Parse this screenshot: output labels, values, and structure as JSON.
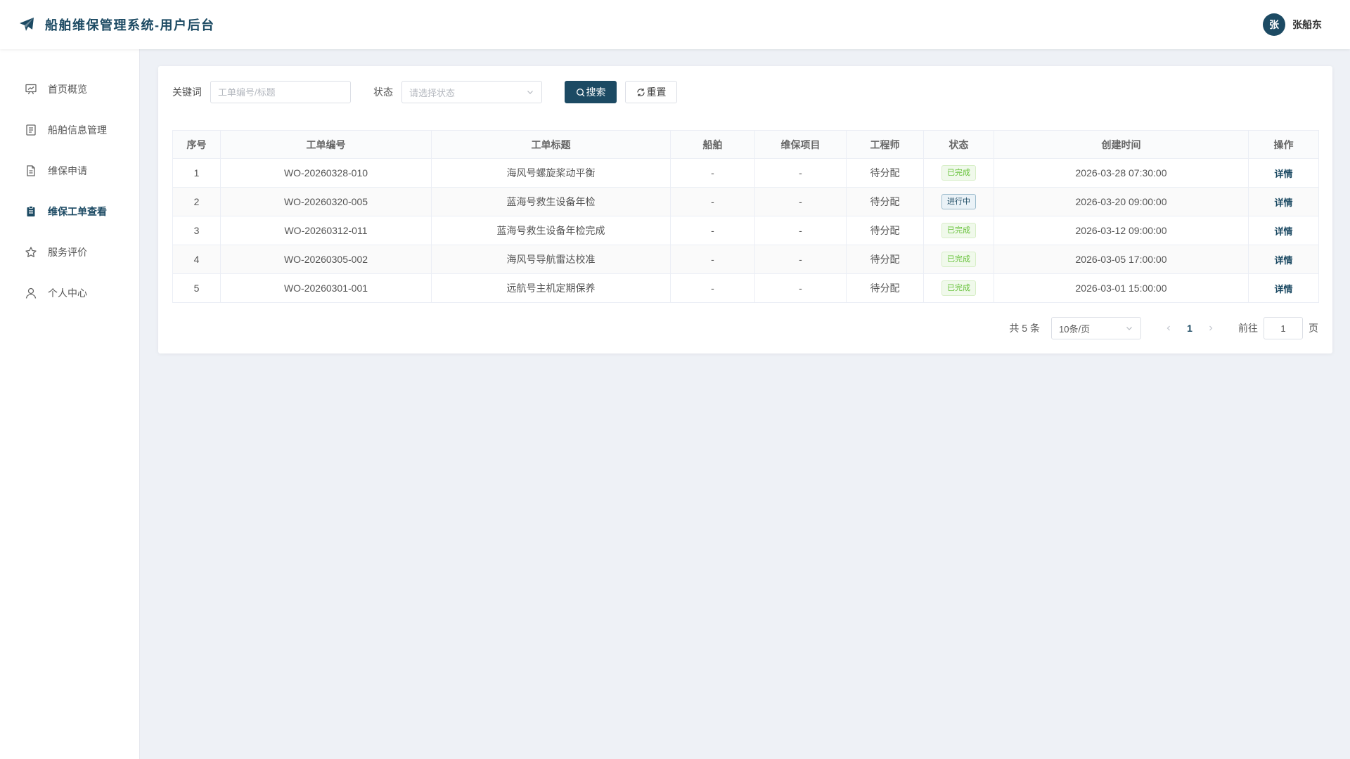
{
  "header": {
    "title": "船舶维保管理系统-用户后台",
    "user": {
      "avatar_text": "张",
      "name": "张船东"
    }
  },
  "sidebar": {
    "items": [
      {
        "label": "首页概览",
        "icon": "chart-board-icon",
        "active": false
      },
      {
        "label": "船舶信息管理",
        "icon": "document-icon",
        "active": false
      },
      {
        "label": "维保申请",
        "icon": "document-edit-icon",
        "active": false
      },
      {
        "label": "维保工单查看",
        "icon": "clipboard-icon",
        "active": true
      },
      {
        "label": "服务评价",
        "icon": "star-icon",
        "active": false
      },
      {
        "label": "个人中心",
        "icon": "user-icon",
        "active": false
      }
    ]
  },
  "filter": {
    "keyword_label": "关键词",
    "keyword_placeholder": "工单编号/标题",
    "keyword_value": "",
    "status_label": "状态",
    "status_placeholder": "请选择状态",
    "search_label": "搜索",
    "reset_label": "重置"
  },
  "table": {
    "columns": [
      "序号",
      "工单编号",
      "工单标题",
      "船舶",
      "维保项目",
      "工程师",
      "状态",
      "创建时间",
      "操作"
    ],
    "rows": [
      {
        "index": "1",
        "code": "WO-20260328-010",
        "title": "海风号螺旋桨动平衡",
        "ship": "-",
        "item": "-",
        "engineer": "待分配",
        "status": "已完成",
        "status_type": "done",
        "created": "2026-03-28 07:30:00",
        "action": "详情"
      },
      {
        "index": "2",
        "code": "WO-20260320-005",
        "title": "蓝海号救生设备年检",
        "ship": "-",
        "item": "-",
        "engineer": "待分配",
        "status": "进行中",
        "status_type": "progress",
        "created": "2026-03-20 09:00:00",
        "action": "详情"
      },
      {
        "index": "3",
        "code": "WO-20260312-011",
        "title": "蓝海号救生设备年检完成",
        "ship": "-",
        "item": "-",
        "engineer": "待分配",
        "status": "已完成",
        "status_type": "done",
        "created": "2026-03-12 09:00:00",
        "action": "详情"
      },
      {
        "index": "4",
        "code": "WO-20260305-002",
        "title": "海风号导航雷达校准",
        "ship": "-",
        "item": "-",
        "engineer": "待分配",
        "status": "已完成",
        "status_type": "done",
        "created": "2026-03-05 17:00:00",
        "action": "详情"
      },
      {
        "index": "5",
        "code": "WO-20260301-001",
        "title": "远航号主机定期保养",
        "ship": "-",
        "item": "-",
        "engineer": "待分配",
        "status": "已完成",
        "status_type": "done",
        "created": "2026-03-01 15:00:00",
        "action": "详情"
      }
    ]
  },
  "pagination": {
    "total_text": "共 5 条",
    "page_size": "10条/页",
    "current_page": "1",
    "goto_label": "前往",
    "goto_value": "1",
    "page_unit": "页"
  },
  "colors": {
    "accent": "#1c4a63",
    "done": "#67c23a",
    "background": "#eef1f6"
  }
}
